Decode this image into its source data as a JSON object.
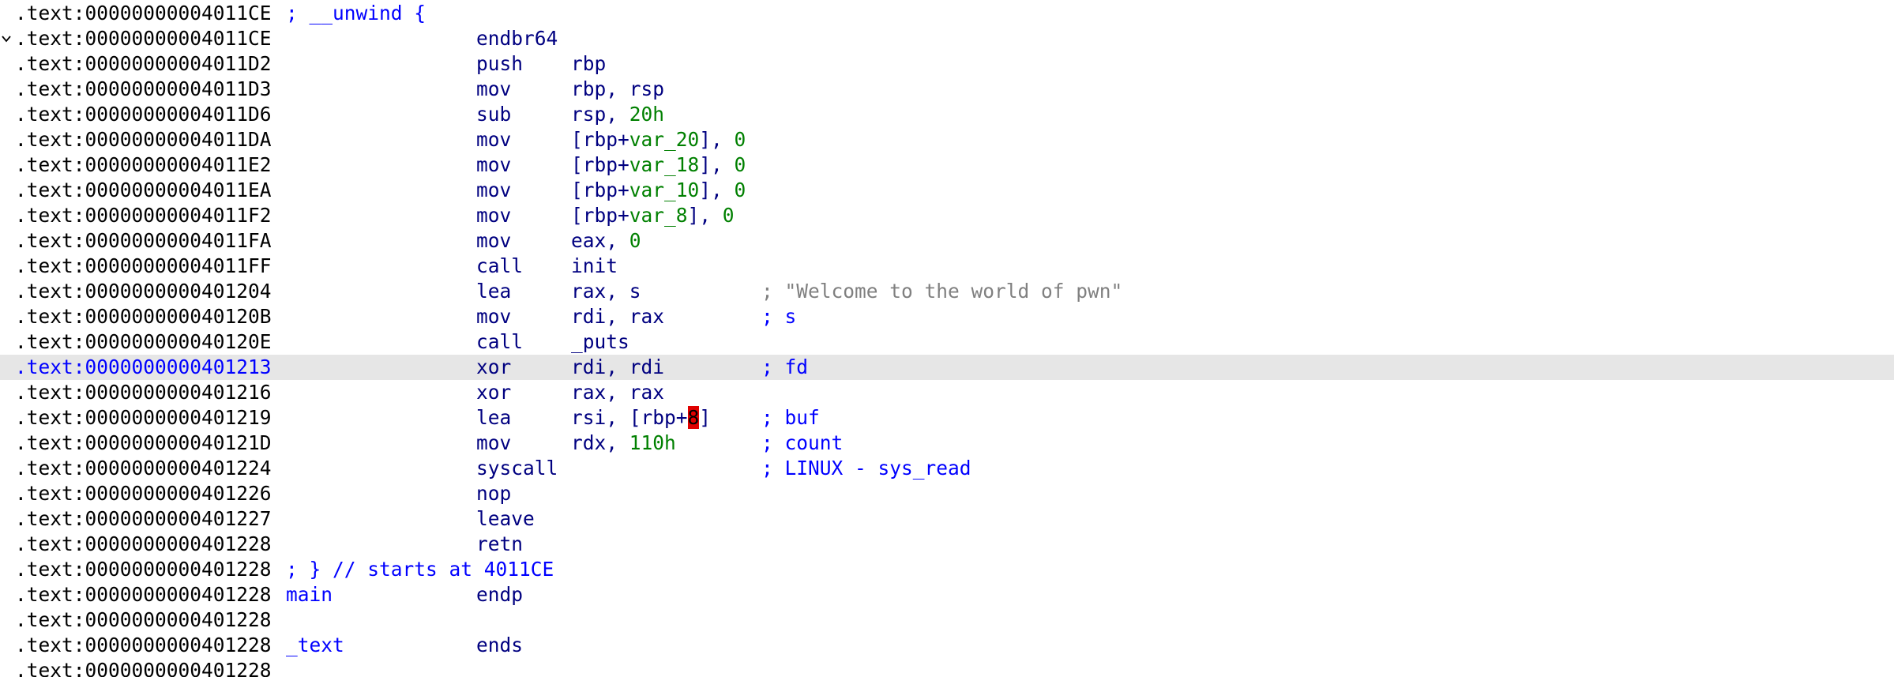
{
  "colors": {
    "background": "#ffffff",
    "selected_line": "#e6e6e6",
    "address": "#000000",
    "selected_address": "#0000ff",
    "label": "#0000ff",
    "mnemonic": "#000080",
    "variable": "#008000",
    "number": "#008000",
    "comment": "#0000ff",
    "string_comment": "#808080",
    "cursor_highlight": "#e00000"
  },
  "lines": [
    {
      "addr": ".text:00000000004011CE",
      "label": "; __unwind {",
      "mnemonic": "",
      "operands": [],
      "comment": ""
    },
    {
      "addr": ".text:00000000004011CE",
      "label": "",
      "mnemonic": "endbr64",
      "operands": [],
      "comment": "",
      "collapse_icon": "chevron-down-icon"
    },
    {
      "addr": ".text:00000000004011D2",
      "label": "",
      "mnemonic": "push",
      "operands": [
        {
          "t": "rbp",
          "k": "plain"
        }
      ],
      "comment": ""
    },
    {
      "addr": ".text:00000000004011D3",
      "label": "",
      "mnemonic": "mov",
      "operands": [
        {
          "t": "rbp, rsp",
          "k": "plain"
        }
      ],
      "comment": ""
    },
    {
      "addr": ".text:00000000004011D6",
      "label": "",
      "mnemonic": "sub",
      "operands": [
        {
          "t": "rsp, ",
          "k": "plain"
        },
        {
          "t": "20h",
          "k": "num"
        }
      ],
      "comment": ""
    },
    {
      "addr": ".text:00000000004011DA",
      "label": "",
      "mnemonic": "mov",
      "operands": [
        {
          "t": "[rbp+",
          "k": "plain"
        },
        {
          "t": "var_20",
          "k": "var"
        },
        {
          "t": "], ",
          "k": "plain"
        },
        {
          "t": "0",
          "k": "num"
        }
      ],
      "comment": ""
    },
    {
      "addr": ".text:00000000004011E2",
      "label": "",
      "mnemonic": "mov",
      "operands": [
        {
          "t": "[rbp+",
          "k": "plain"
        },
        {
          "t": "var_18",
          "k": "var"
        },
        {
          "t": "], ",
          "k": "plain"
        },
        {
          "t": "0",
          "k": "num"
        }
      ],
      "comment": ""
    },
    {
      "addr": ".text:00000000004011EA",
      "label": "",
      "mnemonic": "mov",
      "operands": [
        {
          "t": "[rbp+",
          "k": "plain"
        },
        {
          "t": "var_10",
          "k": "var"
        },
        {
          "t": "], ",
          "k": "plain"
        },
        {
          "t": "0",
          "k": "num"
        }
      ],
      "comment": ""
    },
    {
      "addr": ".text:00000000004011F2",
      "label": "",
      "mnemonic": "mov",
      "operands": [
        {
          "t": "[rbp+",
          "k": "plain"
        },
        {
          "t": "var_8",
          "k": "var"
        },
        {
          "t": "], ",
          "k": "plain"
        },
        {
          "t": "0",
          "k": "num"
        }
      ],
      "comment": ""
    },
    {
      "addr": ".text:00000000004011FA",
      "label": "",
      "mnemonic": "mov",
      "operands": [
        {
          "t": "eax, ",
          "k": "plain"
        },
        {
          "t": "0",
          "k": "num"
        }
      ],
      "comment": ""
    },
    {
      "addr": ".text:00000000004011FF",
      "label": "",
      "mnemonic": "call",
      "operands": [
        {
          "t": "init",
          "k": "plain"
        }
      ],
      "comment": ""
    },
    {
      "addr": ".text:0000000000401204",
      "label": "",
      "mnemonic": "lea",
      "operands": [
        {
          "t": "rax, s",
          "k": "plain"
        }
      ],
      "comment": "; \"Welcome to the world of pwn\"",
      "comment_is_string": true
    },
    {
      "addr": ".text:000000000040120B",
      "label": "",
      "mnemonic": "mov",
      "operands": [
        {
          "t": "rdi, rax",
          "k": "plain"
        }
      ],
      "comment": "; s"
    },
    {
      "addr": ".text:000000000040120E",
      "label": "",
      "mnemonic": "call",
      "operands": [
        {
          "t": "_puts",
          "k": "plain"
        }
      ],
      "comment": ""
    },
    {
      "addr": ".text:0000000000401213",
      "label": "",
      "mnemonic": "xor",
      "operands": [
        {
          "t": "rdi, rdi",
          "k": "plain"
        }
      ],
      "comment": "; fd",
      "selected": true
    },
    {
      "addr": ".text:0000000000401216",
      "label": "",
      "mnemonic": "xor",
      "operands": [
        {
          "t": "rax, rax",
          "k": "plain"
        }
      ],
      "comment": ""
    },
    {
      "addr": ".text:0000000000401219",
      "label": "",
      "mnemonic": "lea",
      "operands": [
        {
          "t": "rsi, [rbp+",
          "k": "plain"
        },
        {
          "t": "8",
          "k": "cursor"
        },
        {
          "t": "]",
          "k": "plain"
        }
      ],
      "comment": "; buf"
    },
    {
      "addr": ".text:000000000040121D",
      "label": "",
      "mnemonic": "mov",
      "operands": [
        {
          "t": "rdx, ",
          "k": "plain"
        },
        {
          "t": "110h",
          "k": "num"
        }
      ],
      "comment": "; count"
    },
    {
      "addr": ".text:0000000000401224",
      "label": "",
      "mnemonic": "syscall",
      "operands": [],
      "comment": "; LINUX - sys_read"
    },
    {
      "addr": ".text:0000000000401226",
      "label": "",
      "mnemonic": "nop",
      "operands": [],
      "comment": ""
    },
    {
      "addr": ".text:0000000000401227",
      "label": "",
      "mnemonic": "leave",
      "operands": [],
      "comment": ""
    },
    {
      "addr": ".text:0000000000401228",
      "label": "",
      "mnemonic": "retn",
      "operands": [],
      "comment": ""
    },
    {
      "addr": ".text:0000000000401228",
      "label": "; } // starts at 4011CE",
      "mnemonic": "",
      "operands": [],
      "comment": ""
    },
    {
      "addr": ".text:0000000000401228",
      "label": "main",
      "mnemonic": "endp",
      "operands": [],
      "comment": ""
    },
    {
      "addr": ".text:0000000000401228",
      "label": "",
      "mnemonic": "",
      "operands": [],
      "comment": ""
    },
    {
      "addr": ".text:0000000000401228",
      "label": "_text",
      "mnemonic": "ends",
      "operands": [],
      "comment": ""
    },
    {
      "addr": ".text:0000000000401228",
      "label": "",
      "mnemonic": "",
      "operands": [],
      "comment": ""
    }
  ]
}
